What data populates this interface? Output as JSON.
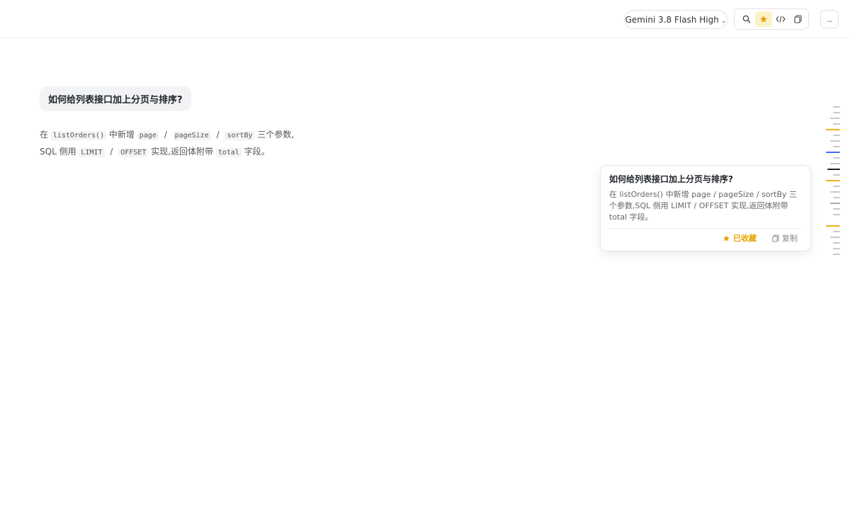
{
  "header": {
    "model_label": "Gemini 3.8 Flash High",
    "toolbar_icons": [
      "search-icon",
      "star-icon",
      "code-icon",
      "copy-icon"
    ],
    "active_icon": "star-icon",
    "more_label": "..."
  },
  "conversation": {
    "question": "如何给列表接口加上分页与排序?",
    "answer_parts": {
      "p1": "在",
      "c1": "listOrders()",
      "p2": "中新增",
      "c2": "page",
      "s1": "/",
      "c3": "pageSize",
      "s2": "/",
      "c4": "sortBy",
      "p3": "三个参数,",
      "p4": "SQL 侧用",
      "c5": "LIMIT",
      "s3": "/",
      "c6": "OFFSET",
      "p5": "实现,返回体附带",
      "c7": "total",
      "p6": "字段。"
    }
  },
  "preview": {
    "title": "如何给列表接口加上分页与排序?",
    "body": "在 listOrders() 中新增 page / pageSize / sortBy 三个参数,SQL 侧用 LIMIT / OFFSET 实现,返回体附带 total 字段。",
    "starred_label": "已收藏",
    "copy_label": "复制"
  },
  "colors": {
    "accent_star": "#e5a400",
    "minimap_blue": "#3b6ff5",
    "minimap_orange": "#f2b01e",
    "minimap_dark": "#222222",
    "minimap_gray": "#c9c9c9"
  }
}
